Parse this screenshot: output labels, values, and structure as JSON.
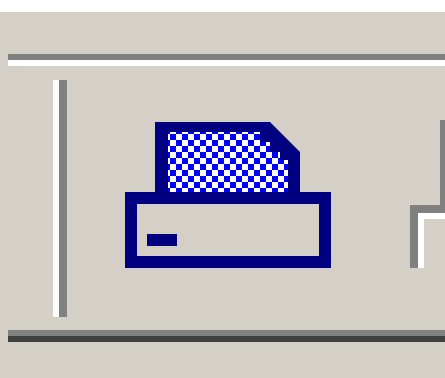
{
  "toolbar": {
    "print_button": {
      "icon": "printer-icon",
      "tooltip": ""
    },
    "next_button": {
      "icon": "toolbar-button-partial"
    }
  },
  "colors": {
    "face": "#d4d0c8",
    "highlight": "#ffffff",
    "shadow": "#808080",
    "dark_shadow": "#404040",
    "icon_navy": "#000080",
    "icon_blue": "#0000ff"
  }
}
